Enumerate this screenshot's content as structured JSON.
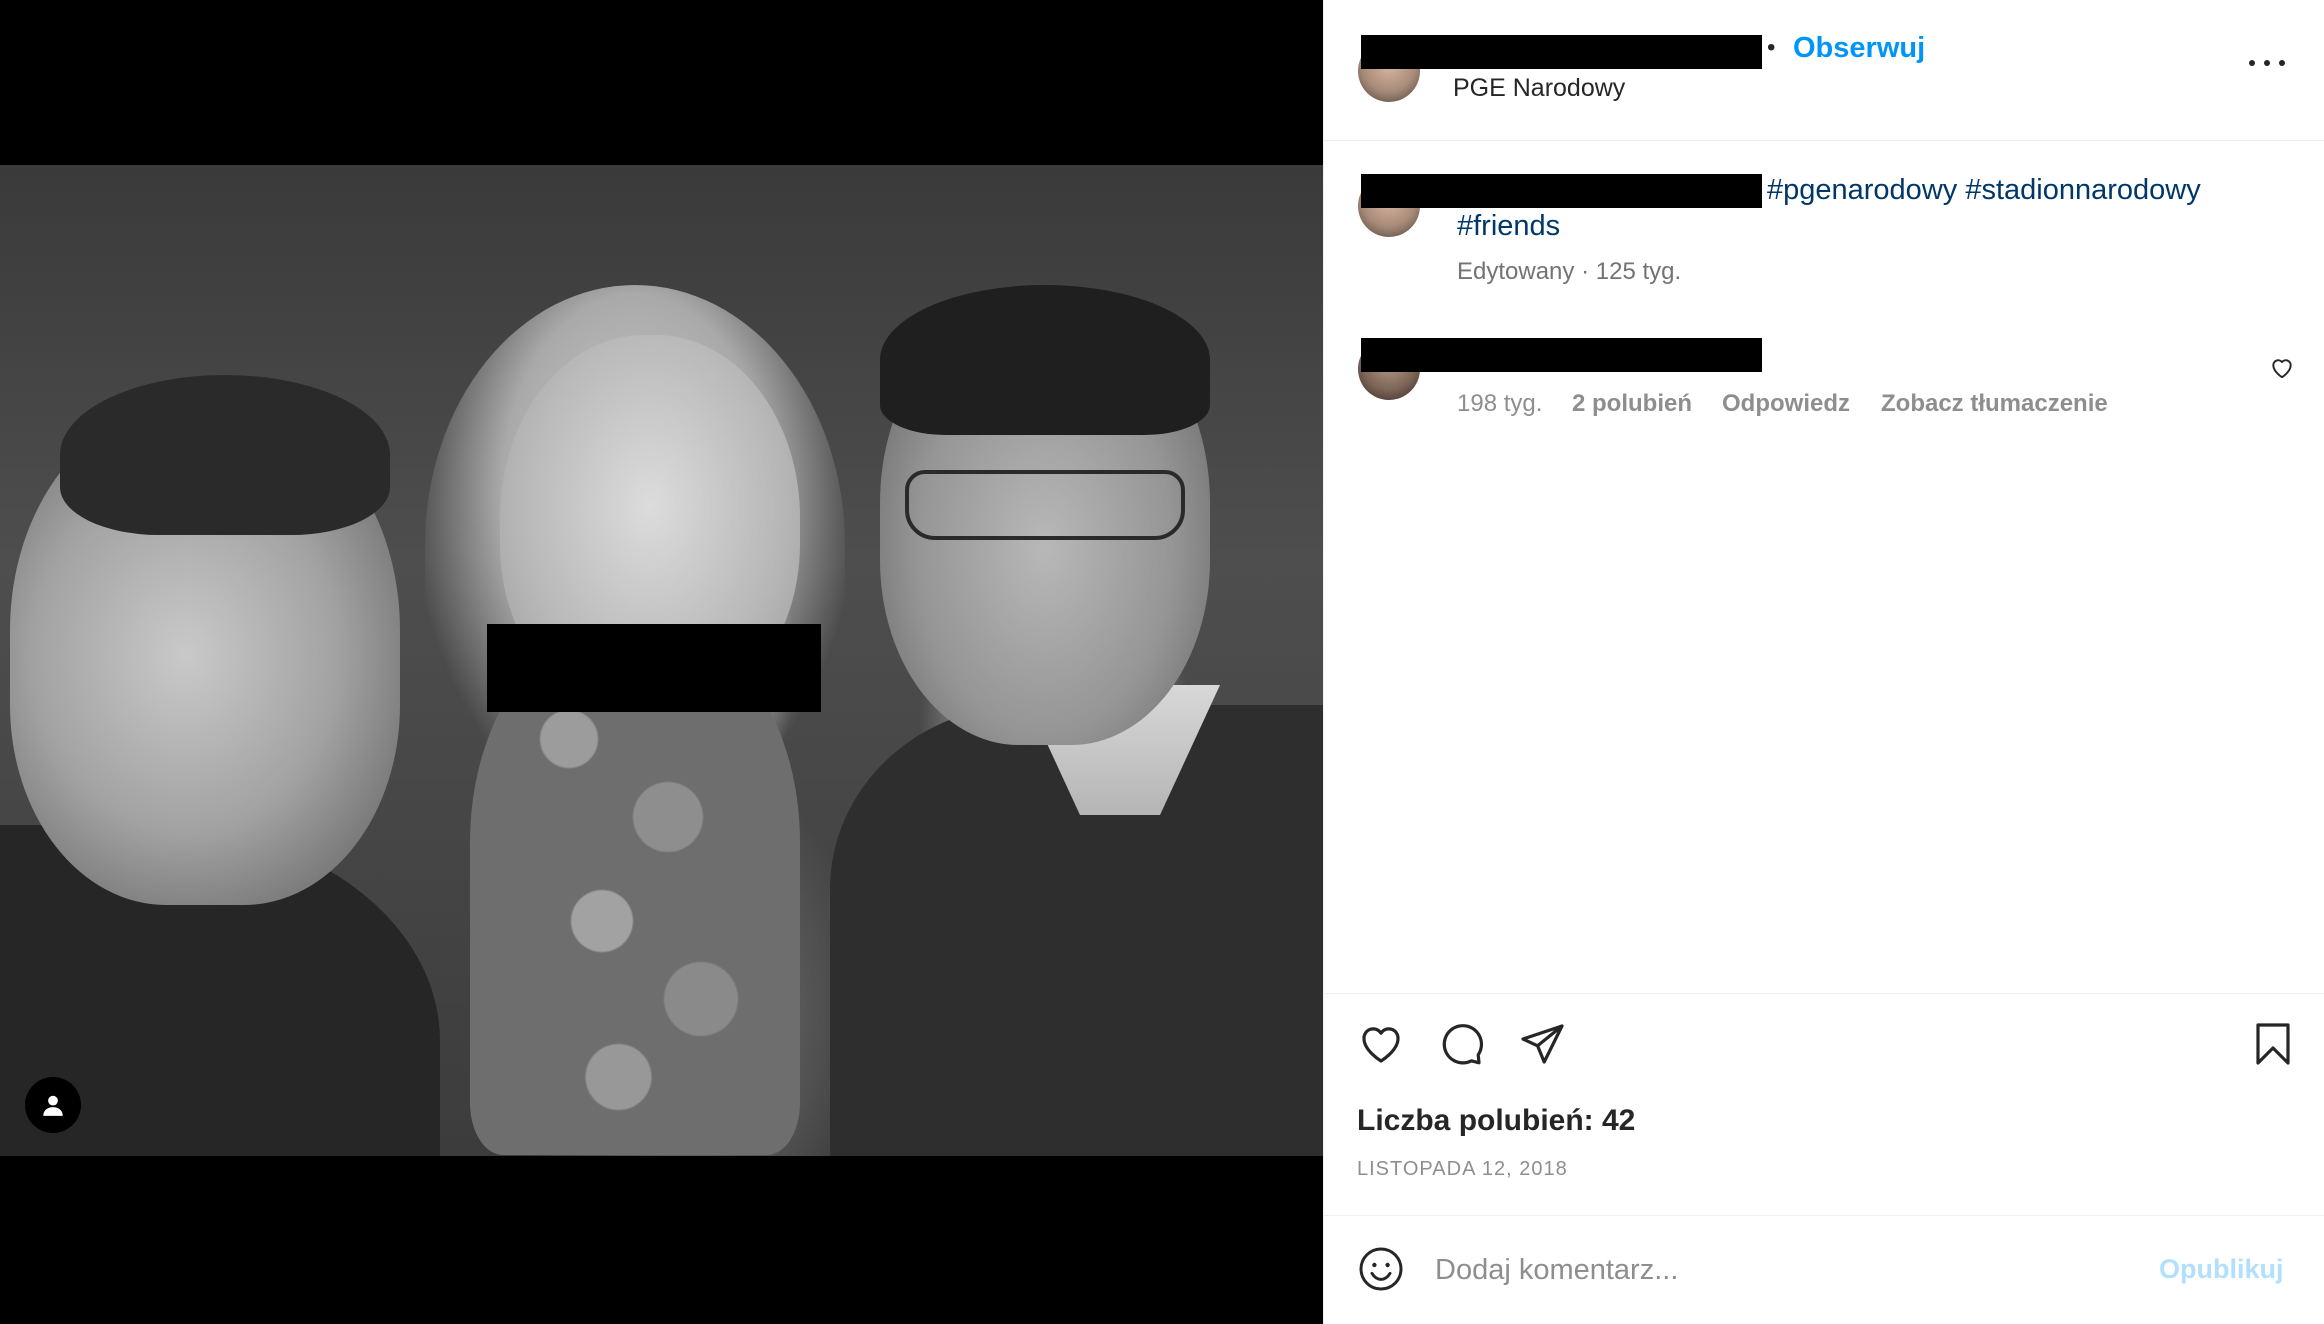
{
  "post": {
    "location": "PGE Narodowy",
    "follow_label": "Obserwuj",
    "separator": "•"
  },
  "caption": {
    "hashtags": [
      "#pgenarodowy",
      "#stadionnarodowy",
      "#friends"
    ],
    "edited": "Edytowany",
    "dot": "·",
    "time": "125 tyg."
  },
  "comment": {
    "time": "198 tyg.",
    "likes": "2 polubień",
    "reply_label": "Odpowiedz",
    "translate_label": "Zobacz tłumaczenie"
  },
  "stats": {
    "likes_label": "Liczba polubień: 42",
    "date": "LISTOPADA 12, 2018"
  },
  "add_comment": {
    "placeholder": "Dodaj komentarz...",
    "publish_label": "Opublikuj"
  },
  "colors": {
    "accent": "#0095f6",
    "hashtag": "#00376b",
    "muted": "#8e8e8e",
    "publish_disabled": "#b2dffc"
  },
  "icons": [
    "user-tag-icon",
    "more-options-icon",
    "heart-icon",
    "comment-icon",
    "share-icon",
    "bookmark-icon",
    "emoji-icon",
    "comment-like-icon"
  ]
}
